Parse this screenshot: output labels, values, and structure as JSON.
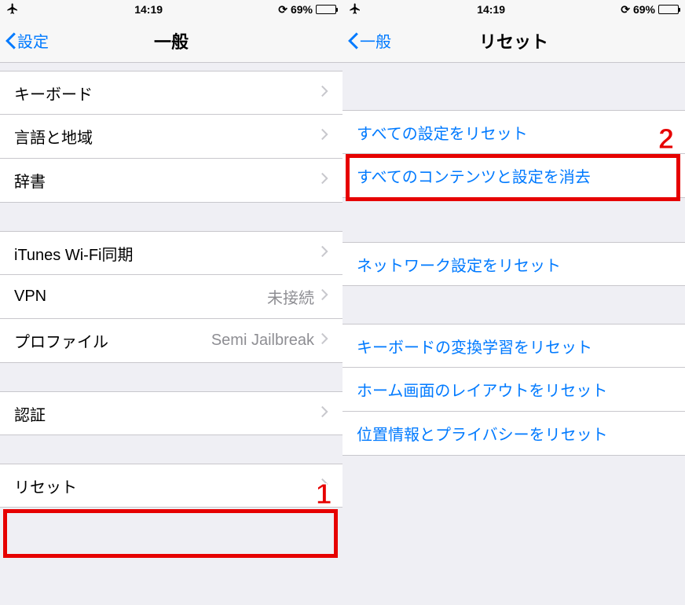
{
  "status": {
    "time": "14:19",
    "battery_pct": "69%",
    "battery_level": 69
  },
  "left": {
    "back_label": "設定",
    "title": "一般",
    "group1": [
      {
        "label": "キーボード"
      },
      {
        "label": "言語と地域"
      },
      {
        "label": "辞書"
      }
    ],
    "group2": [
      {
        "label": "iTunes Wi-Fi同期"
      },
      {
        "label": "VPN",
        "value": "未接続"
      },
      {
        "label": "プロファイル",
        "value": "Semi Jailbreak"
      }
    ],
    "group3": [
      {
        "label": "認証"
      }
    ],
    "group4": [
      {
        "label": "リセット"
      }
    ],
    "callout": "1"
  },
  "right": {
    "back_label": "一般",
    "title": "リセット",
    "group1": [
      {
        "label": "すべての設定をリセット"
      },
      {
        "label": "すべてのコンテンツと設定を消去"
      }
    ],
    "group2": [
      {
        "label": "ネットワーク設定をリセット"
      }
    ],
    "group3": [
      {
        "label": "キーボードの変換学習をリセット"
      },
      {
        "label": "ホーム画面のレイアウトをリセット"
      },
      {
        "label": "位置情報とプライバシーをリセット"
      }
    ],
    "callout": "2"
  }
}
